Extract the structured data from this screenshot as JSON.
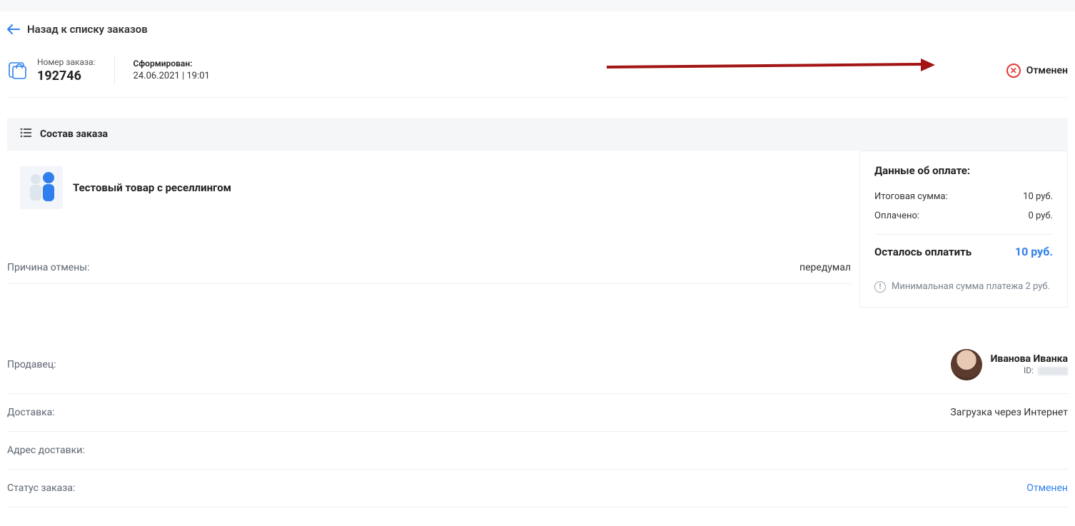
{
  "back_label": "Назад к списку заказов",
  "order": {
    "id_label": "Номер заказа:",
    "id_value": "192746",
    "formed_label": "Сформирован:",
    "formed_value": "24.06.2021 | 19:01",
    "status_text": "Отменен"
  },
  "section_title": "Состав заказа",
  "product": {
    "name": "Тестовый товар с реселлингом"
  },
  "cancel_reason": {
    "label": "Причина отмены:",
    "value": "передумал"
  },
  "payment": {
    "title": "Данные об оплате:",
    "total_label": "Итоговая сумма:",
    "total_value": "10 руб.",
    "paid_label": "Оплачено:",
    "paid_value": "0 руб.",
    "remaining_label": "Осталось оплатить",
    "remaining_value": "10 руб.",
    "min_note": "Минимальная сумма платежа 2 руб."
  },
  "details": {
    "seller_label": "Продавец:",
    "seller_name": "Иванова Иванка",
    "seller_id_prefix": "ID:",
    "delivery_label": "Доставка:",
    "delivery_value": "Загрузка через Интернет",
    "address_label": "Адрес доставки:",
    "address_value": "",
    "status_label": "Статус заказа:",
    "status_value": "Отменен"
  }
}
